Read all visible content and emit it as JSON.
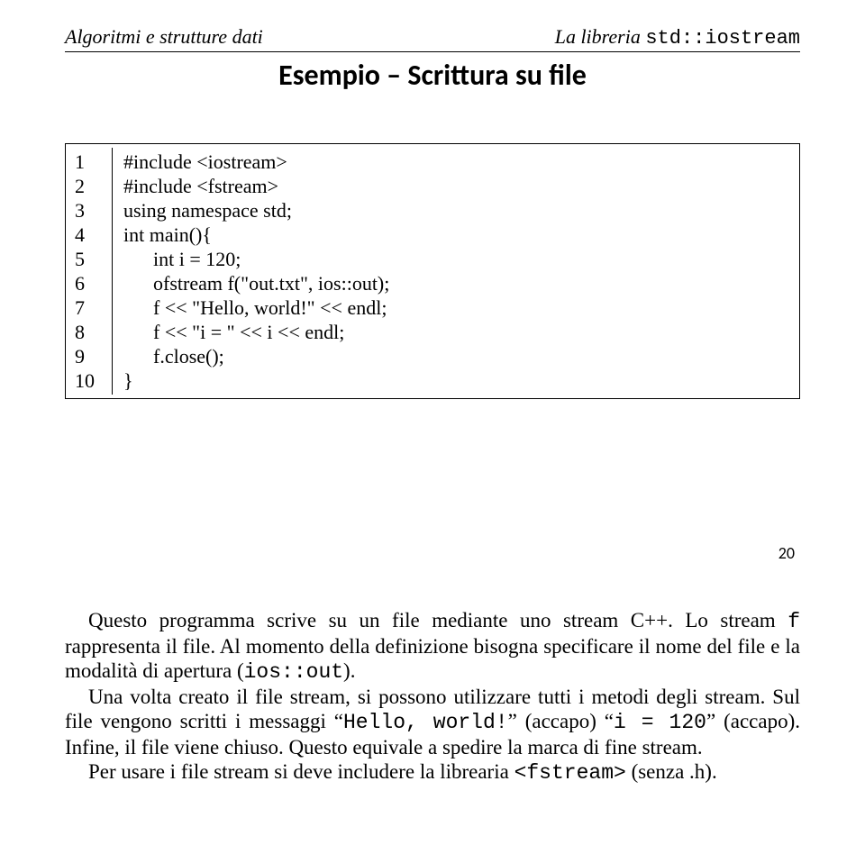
{
  "header": {
    "left": "Algoritmi e strutture dati",
    "right_italic": "La libreria ",
    "right_mono": "std::iostream"
  },
  "title": "Esempio – Scrittura su file",
  "code": {
    "nums": [
      "1",
      "2",
      "3",
      "4",
      "5",
      "6",
      "7",
      "8",
      "9",
      "10"
    ],
    "lines": [
      "#include <iostream>",
      "#include <fstream>",
      "using namespace std;",
      "int main(){",
      "      int i = 120;",
      "      ofstream f(\"out.txt\", ios::out);",
      "      f << \"Hello, world!\" << endl;",
      "      f << \"i = \" << i << endl;",
      "      f.close();",
      "}"
    ]
  },
  "slide_number": "20",
  "paragraphs": {
    "p1a": "Questo programma scrive su un file mediante uno stream C++. Lo stream ",
    "p1b": "f",
    "p1c": " rappresenta il file. Al momento della definizione bisogna specificare il nome del file e la modalità di apertura (",
    "p1d": "ios::out",
    "p1e": ").",
    "p2a": "Una volta creato il file stream, si possono utilizzare tutti i metodi degli stream. Sul file vengono scritti i messaggi “",
    "p2b": "Hello, world!",
    "p2c": "” (accapo) “",
    "p2d": "i = 120",
    "p2e": "” (accapo). Infine, il file viene chiuso. Questo equivale a spedire la marca di fine stream.",
    "p3a": "Per usare i file stream si deve includere la librearia ",
    "p3b": "<fstream>",
    "p3c": " (senza .h)."
  }
}
